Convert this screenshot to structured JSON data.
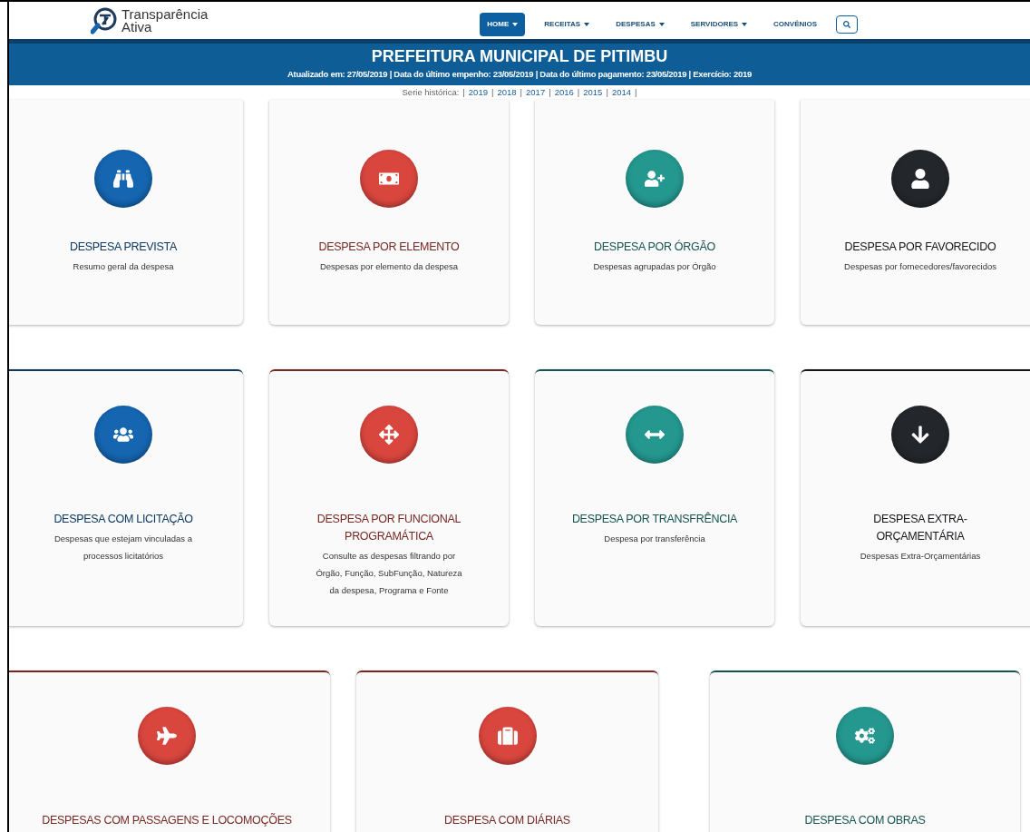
{
  "logo": {
    "line_1": "Transparência",
    "line_2": "Ativa"
  },
  "nav": [
    {
      "label": "HOME",
      "dropdown": true,
      "selected": true
    },
    {
      "label": "RECEITAS",
      "dropdown": true,
      "selected": false
    },
    {
      "label": "DESPESAS",
      "dropdown": true,
      "selected": false
    },
    {
      "label": "SERVIDORES",
      "dropdown": true,
      "selected": false
    },
    {
      "label": "CONVÊNIOS",
      "dropdown": false,
      "selected": false
    }
  ],
  "banner": {
    "title": "PREFEITURA MUNICIPAL DE PITIMBU",
    "subtitle": "Atualizado em: 27/05/2019 | Data do último empenho: 23/05/2019 | Data do último pagamento: 23/05/2019 | Exercício: 2019"
  },
  "series": {
    "label": "Serie histórica:",
    "separator": "|",
    "years": [
      "2019",
      "2018",
      "2017",
      "2016",
      "2015",
      "2014"
    ]
  },
  "card_rows": [
    [
      {
        "title": "DESPESA PREVISTA",
        "description": "Resumo geral da despesa",
        "color": "#1565b0"
      },
      {
        "title": "DESPESA POR ELEMENTO",
        "description": "Despesas por elemento da despesa",
        "color": "#d9463e"
      },
      {
        "title": "DESPESA POR ÓRGÃO",
        "description": "Despesas agrupadas por Órgão",
        "color": "#24978f"
      },
      {
        "title": "DESPESA POR FAVORECIDO",
        "description": "Despesas por fornecedores/favorecidos",
        "color": "#23262b"
      }
    ],
    [
      {
        "title": "DESPESA COM LICITAÇÃO",
        "description": "Despesas que estejam vinculadas a processos licitatórios",
        "color": "#1565b0"
      },
      {
        "title": "DESPESA POR FUNCIONAL PROGRAMÁTICA",
        "description": "Consulte as despesas filtrando por Órgão, Função, SubFunção, Natureza da despesa, Programa e Fonte",
        "color": "#d9463e"
      },
      {
        "title": "DESPESA POR TRANSFRÊNCIA",
        "description": "Despesa por transferência",
        "color": "#24978f"
      },
      {
        "title": "DESPESA EXTRA-ORÇAMENTÁRIA",
        "description": "Despesas Extra-Orçamentárias",
        "color": "#23262b"
      }
    ],
    [
      {
        "title": "DESPESAS COM PASSAGENS E LOCOMOÇÕES",
        "color": "#d9463e"
      },
      {
        "title": "DESPESA COM DIÁRIAS",
        "color": "#d9463e"
      },
      {
        "title": "DESPESA COM OBRAS",
        "color": "#24978f"
      }
    ]
  ]
}
